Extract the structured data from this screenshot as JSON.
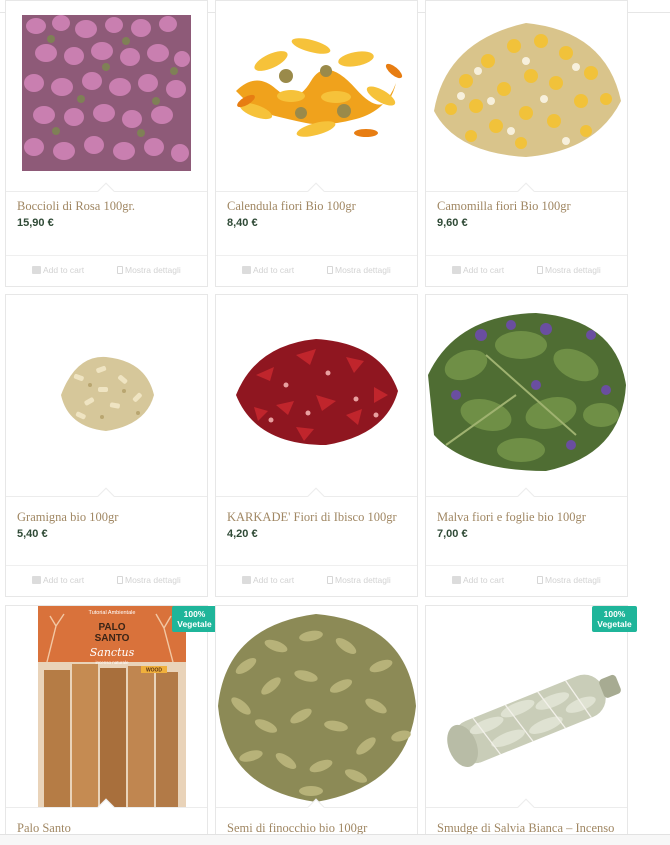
{
  "products": [
    {
      "title": "Boccioli di Rosa 100gr.",
      "price": "15,90 €",
      "add_to_cart": "Add to cart",
      "details": "Mostra dettagli",
      "image": "rose-buds"
    },
    {
      "title": "Calendula fiori Bio 100gr",
      "price": "8,40 €",
      "add_to_cart": "Add to cart",
      "details": "Mostra dettagli",
      "image": "calendula-petals"
    },
    {
      "title": "Camomilla fiori Bio 100gr",
      "price": "9,60 €",
      "add_to_cart": "Add to cart",
      "details": "Mostra dettagli",
      "image": "chamomile-flowers"
    },
    {
      "title": "Gramigna bio 100gr",
      "price": "5,40 €",
      "add_to_cart": "Add to cart",
      "details": "Mostra dettagli",
      "image": "couch-grass-root"
    },
    {
      "title": "KARKADE' Fiori di Ibisco 100gr",
      "price": "4,20 €",
      "add_to_cart": "Add to cart",
      "details": "Mostra dettagli",
      "image": "hibiscus-flowers"
    },
    {
      "title": "Malva fiori e foglie bio 100gr",
      "price": "7,00 €",
      "add_to_cart": "Add to cart",
      "details": "Mostra dettagli",
      "image": "mallow-leaves"
    },
    {
      "title": "Palo Santo",
      "badge": "100% Vegetale",
      "image": "palo-santo-package",
      "package": {
        "brand_top": "Tutorial Ambientale",
        "name_line1": "PALO",
        "name_line2": "SANTO",
        "script": "Sanctus",
        "sub": "incenso naturale",
        "tag": "WOOD"
      }
    },
    {
      "title": "Semi di finocchio bio 100gr",
      "image": "fennel-seeds"
    },
    {
      "title": "Smudge di Salvia Bianca – Incenso",
      "badge": "100% Vegetale",
      "image": "white-sage-bundle"
    }
  ]
}
